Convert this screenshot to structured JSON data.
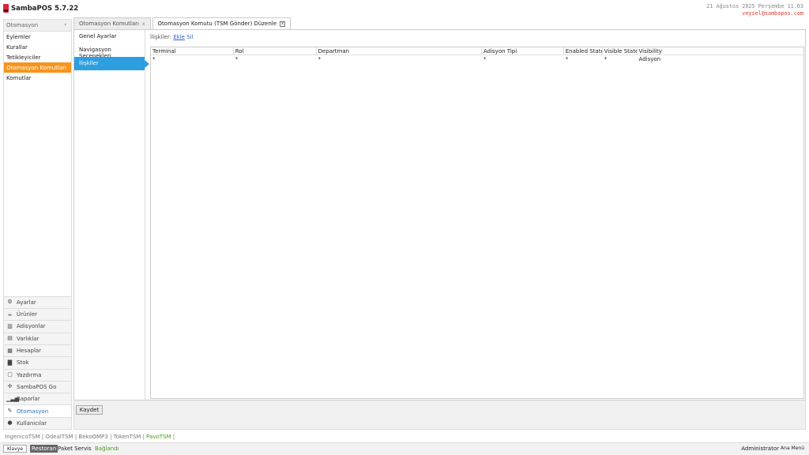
{
  "app": {
    "title": "SambaPOS 5.7.22"
  },
  "header": {
    "datetime": "21 Ağustos 2025 Perşembe 11.03",
    "email": "veysel@sambapos.com"
  },
  "sidebar": {
    "heading": "Otomasyon",
    "chevron": "‹",
    "items": [
      {
        "label": "Eylemler"
      },
      {
        "label": "Kurallar"
      },
      {
        "label": "Tetikleyiciler"
      },
      {
        "label": "Otomasyon Komutları"
      },
      {
        "label": "Komutlar"
      }
    ],
    "active_index": 3
  },
  "modules": [
    {
      "label": "Ayarlar",
      "icon": "gear-icon"
    },
    {
      "label": "Ürünler",
      "icon": "product-icon"
    },
    {
      "label": "Adisyonlar",
      "icon": "tickets-icon"
    },
    {
      "label": "Varlıklar",
      "icon": "entities-icon"
    },
    {
      "label": "Hesaplar",
      "icon": "calculator-icon"
    },
    {
      "label": "Stok",
      "icon": "stock-icon"
    },
    {
      "label": "Yazdırma",
      "icon": "printer-icon"
    },
    {
      "label": "SambaPOS Go",
      "icon": "go-icon"
    },
    {
      "label": "Raporlar",
      "icon": "chart-icon"
    },
    {
      "label": "Otomasyon",
      "icon": "automation-icon"
    },
    {
      "label": "Kullanıcılar",
      "icon": "user-icon"
    }
  ],
  "tabs": [
    {
      "label": "Otomasyon Komutları",
      "close": "x"
    },
    {
      "label": "Otomasyon Komutu (TSM Gönder) Düzenle",
      "close": "x"
    }
  ],
  "subnav": [
    {
      "label": "Genel Ayarlar"
    },
    {
      "label": "Navigasyon Seçenekleri"
    },
    {
      "label": "İlişkiler"
    }
  ],
  "relations": {
    "label": "İlişkiler:",
    "add": "Ekle",
    "remove": "Sil"
  },
  "grid": {
    "columns": [
      "Terminal",
      "Rol",
      "Departman",
      "Adisyon Tipi",
      "Enabled States",
      "Visible States",
      "Visibility"
    ],
    "rows": [
      [
        "*",
        "*",
        "*",
        "*",
        "*",
        "*",
        "Adisyon"
      ]
    ]
  },
  "footer": {
    "save": "Kaydet",
    "integrations": [
      "IngenicoTSM",
      "OdealTSM",
      "BekoOMP3",
      "TokenTSM",
      "PavoTSM"
    ],
    "keyboard": "Klavye",
    "restoran": "Restoran",
    "paket": "Paket Servis",
    "status": "Bağlandı",
    "user": "Administrator",
    "main_menu": "Ana Menü"
  },
  "colors": {
    "accent_orange": "#f7941d",
    "accent_blue": "#2d9ee0",
    "logo_red": "#d9263a",
    "email_red": "#e0362c",
    "status_green": "#4a9a1c"
  }
}
